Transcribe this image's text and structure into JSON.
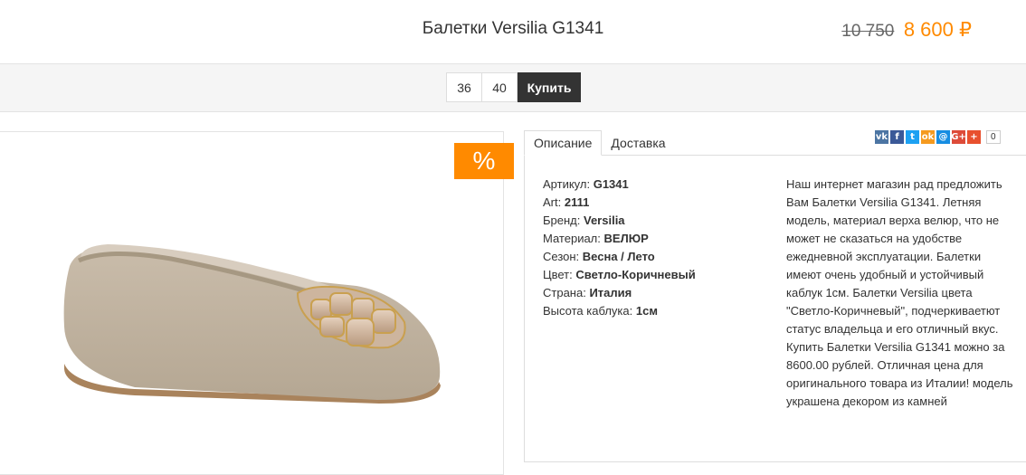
{
  "product": {
    "title": "Балетки Versilia G1341",
    "old_price": "10 750",
    "new_price": "8 600 ₽"
  },
  "sizes": [
    "36",
    "40"
  ],
  "buy_label": "Купить",
  "sale_badge": "%",
  "tabs": [
    {
      "label": "Описание",
      "active": true
    },
    {
      "label": "Доставка",
      "active": false
    }
  ],
  "specs": [
    {
      "label": "Артикул:",
      "value": "G1341"
    },
    {
      "label": "Art:",
      "value": "2111"
    },
    {
      "label": "Бренд:",
      "value": "Versilia"
    },
    {
      "label": "Материал:",
      "value": "ВЕЛЮР"
    },
    {
      "label": "Сезон:",
      "value": "Весна / Лето"
    },
    {
      "label": "Цвет:",
      "value": "Светло-Коричневый"
    },
    {
      "label": "Страна:",
      "value": "Италия"
    },
    {
      "label": "Высота каблука:",
      "value": "1см"
    }
  ],
  "description": "Наш интернет магазин рад предложить Вам Балетки Versilia G1341. Летняя модель, материал верха велюр, что не может не сказаться на удобстве ежедневной эксплуатации. Балетки имеют очень удобный и устойчивый каблук 1см. Балетки Versilia цвета \"Светло-Коричневый\", подчеркиваетют статус владельца и его отличный вкус. Купить Балетки Versilia G1341 можно за 8600.00 рублей. Отличная цена для оригинального товара из Италии! модель украшена декором из камней",
  "share": {
    "icons": [
      {
        "name": "vk-icon",
        "glyph": "vk",
        "color": "#4c75a3"
      },
      {
        "name": "facebook-icon",
        "glyph": "f",
        "color": "#3b5998"
      },
      {
        "name": "twitter-icon",
        "glyph": "t",
        "color": "#1da1f2"
      },
      {
        "name": "odnoklassniki-icon",
        "glyph": "ok",
        "color": "#f59a1f"
      },
      {
        "name": "mail-icon",
        "glyph": "@",
        "color": "#168de2"
      },
      {
        "name": "google-plus-icon",
        "glyph": "G+",
        "color": "#dd4b39"
      },
      {
        "name": "more-icon",
        "glyph": "+",
        "color": "#e8502e"
      }
    ],
    "count": "0"
  }
}
